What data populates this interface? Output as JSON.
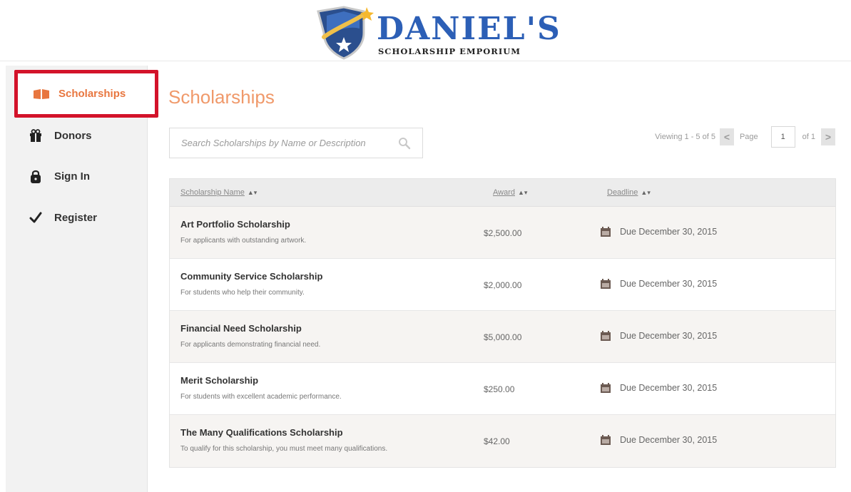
{
  "brand": {
    "title": "DANIEL'S",
    "subtitle": "SCHOLARSHIP EMPORIUM",
    "colors": {
      "title": "#2c5fb6",
      "accent": "#e8763f",
      "highlight_border": "#d3132a"
    }
  },
  "sidebar": {
    "items": [
      {
        "label": "Scholarships",
        "icon": "open-book-icon",
        "active": true
      },
      {
        "label": "Donors",
        "icon": "gift-icon",
        "active": false
      },
      {
        "label": "Sign In",
        "icon": "lock-icon",
        "active": false
      },
      {
        "label": "Register",
        "icon": "checkmark-icon",
        "active": false
      }
    ]
  },
  "main": {
    "title": "Scholarships",
    "search": {
      "placeholder": "Search Scholarships by Name or Description",
      "value": ""
    },
    "pager": {
      "viewing": "Viewing 1 - 5 of 5",
      "prev_label": "<",
      "page_label": "Page",
      "page_value": "1",
      "of_label": "of 1",
      "next_label": ">"
    },
    "table": {
      "columns": [
        {
          "label": "Scholarship Name",
          "sort": "▲▾"
        },
        {
          "label": "Award",
          "sort": "▲▾"
        },
        {
          "label": "Deadline",
          "sort": "▲▾"
        }
      ],
      "rows": [
        {
          "name": "Art Portfolio Scholarship",
          "desc": "For applicants with outstanding artwork.",
          "award": "$2,500.00",
          "deadline": "Due December 30, 2015"
        },
        {
          "name": "Community Service Scholarship",
          "desc": "For students who help their community.",
          "award": "$2,000.00",
          "deadline": "Due December 30, 2015"
        },
        {
          "name": "Financial Need Scholarship",
          "desc": "For applicants demonstrating financial need.",
          "award": "$5,000.00",
          "deadline": "Due December 30, 2015"
        },
        {
          "name": "Merit Scholarship",
          "desc": "For students with excellent academic performance.",
          "award": "$250.00",
          "deadline": "Due December 30, 2015"
        },
        {
          "name": "The Many Qualifications Scholarship",
          "desc": "To qualify for this scholarship, you must meet many qualifications.",
          "award": "$42.00",
          "deadline": "Due December 30, 2015"
        }
      ]
    }
  }
}
